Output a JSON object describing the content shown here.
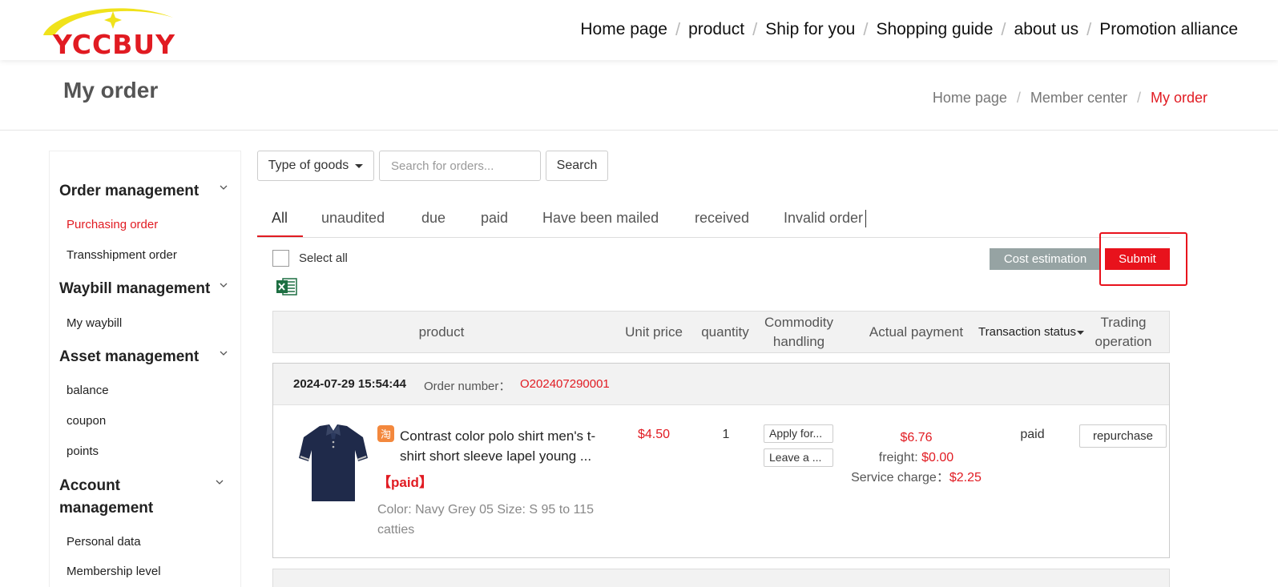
{
  "brand": {
    "logo_text": "YCCBUY",
    "accent": "#e11b22",
    "logo_swoosh": "#f0e21b"
  },
  "nav": {
    "items": [
      "Home page",
      "product",
      "Ship for you",
      "Shopping guide",
      "about us",
      "Promotion alliance"
    ],
    "separator": "/"
  },
  "page": {
    "title": "My order"
  },
  "breadcrumb": {
    "items": [
      "Home page",
      "Member center",
      "My order"
    ],
    "separator": "/"
  },
  "sidebar": {
    "groups": [
      {
        "title": "Order management",
        "items": [
          "Purchasing order",
          "Transshipment order"
        ],
        "active": "Purchasing order"
      },
      {
        "title": "Waybill management",
        "items": [
          "My waybill"
        ]
      },
      {
        "title": "Asset management",
        "items": [
          "balance",
          "coupon",
          "points"
        ]
      },
      {
        "title": "Account management",
        "items": [
          "Personal data",
          "Membership level"
        ]
      }
    ]
  },
  "toolbar": {
    "type_label": "Type of goods",
    "search_placeholder": "Search for orders...",
    "search_button": "Search"
  },
  "tabs": [
    "All",
    "unaudited",
    "due",
    "paid",
    "Have been mailed",
    "received",
    "Invalid order"
  ],
  "active_tab": "All",
  "select_all_label": "Select all",
  "actions": {
    "cost_estimation": "Cost estimation",
    "submit": "Submit"
  },
  "table_headers": {
    "product": "product",
    "unit_price": "Unit price",
    "quantity": "quantity",
    "commodity_handling": "Commodity handling",
    "actual_payment": "Actual payment",
    "transaction_status": "Transaction status",
    "trading_operation": "Trading operation"
  },
  "orders": [
    {
      "date": "2024-07-29 15:54:44",
      "number_label": "Order number：",
      "number": "O202407290001",
      "product": {
        "platform_icon": "淘",
        "name": "Contrast color polo shirt men's t-shirt short sleeve lapel young ...",
        "tag": "【paid】",
        "attrs": "Color: Navy Grey 05 Size: S 95 to 115 catties"
      },
      "unit_price": "$4.50",
      "quantity": "1",
      "handling_buttons": [
        "Apply for...",
        "Leave a ..."
      ],
      "actual_payment": "$6.76",
      "freight_label": "freight:",
      "freight": "$0.00",
      "service_label": "Service charge：",
      "service": "$2.25",
      "status": "paid",
      "operation": "repurchase"
    }
  ]
}
